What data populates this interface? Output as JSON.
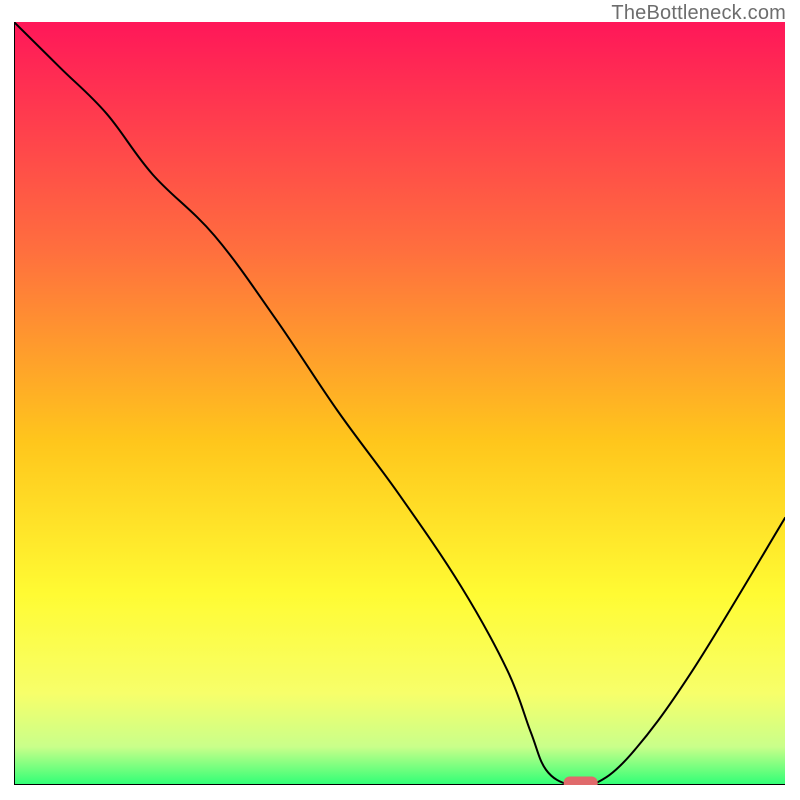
{
  "watermark": "TheBottleneck.com",
  "chart_data": {
    "type": "line",
    "title": "",
    "xlabel": "",
    "ylabel": "",
    "xlim": [
      0,
      100
    ],
    "ylim": [
      0,
      100
    ],
    "x": [
      0,
      6,
      12,
      18,
      26,
      34,
      42,
      50,
      58,
      64,
      67,
      69,
      72,
      75,
      80,
      88,
      100
    ],
    "values": [
      100,
      94,
      88,
      80,
      72,
      61,
      49,
      38,
      26,
      15,
      7,
      2,
      0,
      0,
      4,
      15,
      35
    ],
    "marker": {
      "x": 73.5,
      "y": 0,
      "color": "#e06a6b"
    },
    "gradient_stops": [
      {
        "offset": 0.0,
        "color": "#ff1759"
      },
      {
        "offset": 0.3,
        "color": "#ff6f3e"
      },
      {
        "offset": 0.55,
        "color": "#ffc61c"
      },
      {
        "offset": 0.75,
        "color": "#fffb33"
      },
      {
        "offset": 0.88,
        "color": "#f7ff6a"
      },
      {
        "offset": 0.95,
        "color": "#c9ff8a"
      },
      {
        "offset": 1.0,
        "color": "#2fff76"
      }
    ]
  }
}
